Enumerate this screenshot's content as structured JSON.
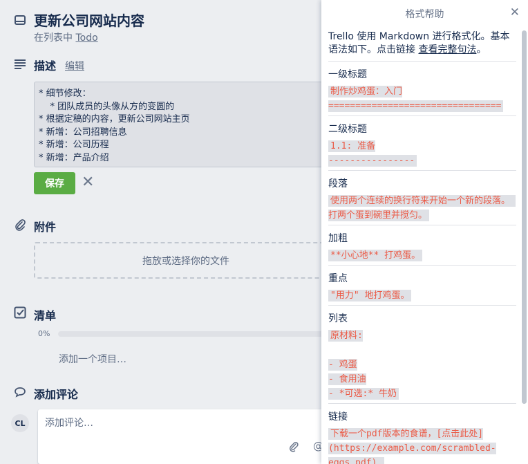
{
  "card": {
    "title": "更新公司网站内容",
    "in_list_prefix": "在列表中 ",
    "list_name": "Todo"
  },
  "description": {
    "heading": "描述",
    "edit_label": "编辑",
    "text": "* 细节修改：\n    * 团队成员的头像从方的变圆的\n* 根据定稿的内容，更新公司网站主页\n* 新增：公司招聘信息\n* 新增：公司历程\n* 新增：产品介绍",
    "save_label": "保存",
    "cancel_label": "✕"
  },
  "attachments": {
    "heading": "附件",
    "dropzone_label": "拖放或选择你的文件"
  },
  "checklist": {
    "heading": "清单",
    "progress_label": "0%",
    "progress": 0,
    "add_item_label": "添加一个项目…"
  },
  "comment": {
    "heading": "添加评论",
    "avatar_initials": "CL",
    "placeholder": "添加评论…",
    "mention_symbol": "@"
  },
  "help": {
    "title": "格式帮助",
    "close_label": "✕",
    "intro_text": "Trello 使用 Markdown 进行格式化。基本语法如下。点击链接 ",
    "intro_link": "查看完整句法",
    "intro_end": "。",
    "sections": [
      {
        "title": "一级标题",
        "example": "制作炒鸡蛋：入门\n================================"
      },
      {
        "title": "二级标题",
        "example": "1.1: 准备\n----------------"
      },
      {
        "title": "段落",
        "example": "使用两个连续的换行符来开始一个新的段落。 打两个蛋到碗里并搅匀。"
      },
      {
        "title": "加粗",
        "example": "**小心地** 打鸡蛋。"
      },
      {
        "title": "重点",
        "example": "\"用力\" 地打鸡蛋。"
      },
      {
        "title": "列表",
        "example": "原材料:\n\n- 鸡蛋\n- 食用油\n- *可选:* 牛奶"
      },
      {
        "title": "链接",
        "example": "下载一个pdf版本的食谱，[点击此处](https://example.com/scrambled-eggs.pdf)."
      }
    ]
  },
  "colors": {
    "save_button": "#5aac44",
    "code_text": "#eb5a46",
    "code_bg": "#dfe1e6"
  }
}
